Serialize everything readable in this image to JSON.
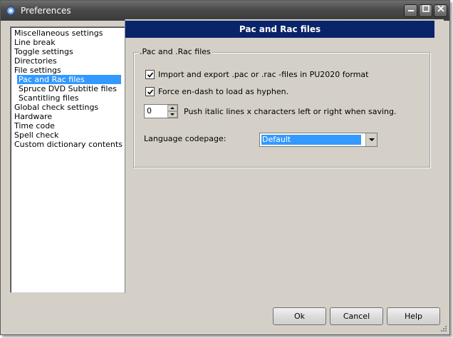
{
  "window": {
    "title": "Preferences"
  },
  "tree": {
    "items": [
      {
        "label": "Miscellaneous settings",
        "level": 0,
        "selected": false
      },
      {
        "label": "Line break",
        "level": 0,
        "selected": false
      },
      {
        "label": "Toggle settings",
        "level": 0,
        "selected": false
      },
      {
        "label": "Directories",
        "level": 0,
        "selected": false
      },
      {
        "label": "File settings",
        "level": 0,
        "selected": false
      },
      {
        "label": "Pac and Rac files",
        "level": 1,
        "selected": true
      },
      {
        "label": "Spruce DVD Subtitle files",
        "level": 1,
        "selected": false
      },
      {
        "label": "Scantitling files",
        "level": 1,
        "selected": false
      },
      {
        "label": "Global check settings",
        "level": 0,
        "selected": false
      },
      {
        "label": "Hardware",
        "level": 0,
        "selected": false
      },
      {
        "label": "Time code",
        "level": 0,
        "selected": false
      },
      {
        "label": "Spell check",
        "level": 0,
        "selected": false
      },
      {
        "label": "Custom dictionary contents",
        "level": 0,
        "selected": false
      }
    ]
  },
  "panel": {
    "header": "Pac and Rac files",
    "group_title": ".Pac and .Rac files",
    "import_export": {
      "label": "Import and export .pac or .rac -files in PU2020 format",
      "checked": true
    },
    "force_endash": {
      "label": "Force en-dash to load as hyphen.",
      "checked": true
    },
    "italic_push": {
      "value": "0",
      "label": "Push italic lines x characters left or right when saving."
    },
    "codepage": {
      "label": "Language codepage:",
      "value": "Default"
    }
  },
  "buttons": {
    "ok": "Ok",
    "cancel": "Cancel",
    "help": "Help"
  },
  "colors": {
    "header_bg": "#0a246a",
    "selection": "#3399ff"
  }
}
